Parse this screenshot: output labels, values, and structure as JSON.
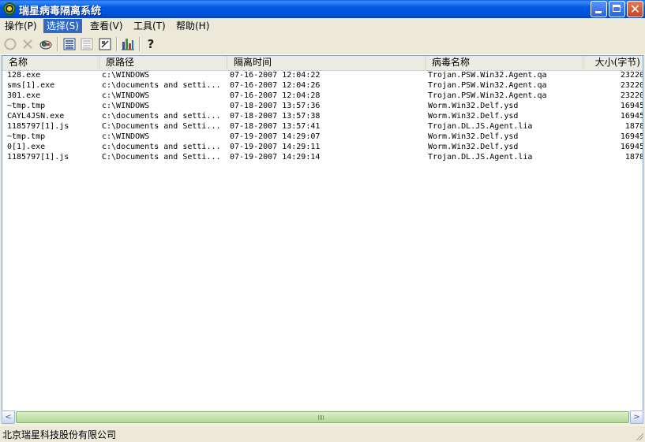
{
  "window": {
    "title": "瑞星病毒隔离系统",
    "close_glyph": "✕"
  },
  "menu": [
    {
      "label": "操作(P)"
    },
    {
      "label": "选择(S)"
    },
    {
      "label": "查看(V)"
    },
    {
      "label": "工具(T)"
    },
    {
      "label": "帮助(H)"
    }
  ],
  "toolbar": {
    "icons": [
      "restore-icon",
      "delete-icon",
      "virus-scan-icon",
      "select-all-icon",
      "select-none-icon",
      "invert-selection-icon",
      "statistics-icon",
      "help-icon"
    ],
    "help_glyph": "?"
  },
  "list": {
    "columns": [
      "名称",
      "原路径",
      "隔离时间",
      "病毒名称",
      "大小(字节)"
    ],
    "rows": [
      {
        "name": "128.exe",
        "path": "c:\\WINDOWS",
        "time": "07-16-2007 12:04:22",
        "virus": "Trojan.PSW.Win32.Agent.qa",
        "size": "23220"
      },
      {
        "name": "sms[1].exe",
        "path": "c:\\documents and setti...",
        "time": "07-16-2007 12:04:26",
        "virus": "Trojan.PSW.Win32.Agent.qa",
        "size": "23220"
      },
      {
        "name": "301.exe",
        "path": "c:\\WINDOWS",
        "time": "07-16-2007 12:04:28",
        "virus": "Trojan.PSW.Win32.Agent.qa",
        "size": "23220"
      },
      {
        "name": "~tmp.tmp",
        "path": "c:\\WINDOWS",
        "time": "07-18-2007 13:57:36",
        "virus": "Worm.Win32.Delf.ysd",
        "size": "16945"
      },
      {
        "name": "CAYL4JSN.exe",
        "path": "c:\\documents and setti...",
        "time": "07-18-2007 13:57:38",
        "virus": "Worm.Win32.Delf.ysd",
        "size": "16945"
      },
      {
        "name": "1185797[1].js",
        "path": "C:\\Documents and Setti...",
        "time": "07-18-2007 13:57:41",
        "virus": "Trojan.DL.JS.Agent.lia",
        "size": "1878"
      },
      {
        "name": "~tmp.tmp",
        "path": "c:\\WINDOWS",
        "time": "07-19-2007 14:29:07",
        "virus": "Worm.Win32.Delf.ysd",
        "size": "16945"
      },
      {
        "name": "0[1].exe",
        "path": "c:\\documents and setti...",
        "time": "07-19-2007 14:29:11",
        "virus": "Worm.Win32.Delf.ysd",
        "size": "16945"
      },
      {
        "name": "1185797[1].js",
        "path": "C:\\Documents and Setti...",
        "time": "07-19-2007 14:29:14",
        "virus": "Trojan.DL.JS.Agent.lia",
        "size": "1878"
      }
    ]
  },
  "scrollbar": {
    "left_glyph": "<",
    "right_glyph": ">"
  },
  "status": {
    "text": "北京瑞星科技股份有限公司"
  },
  "colors": {
    "titlebar": "#0054E3",
    "menu_highlight": "#316AC5",
    "scroll_thumb": "#B6D69A"
  }
}
